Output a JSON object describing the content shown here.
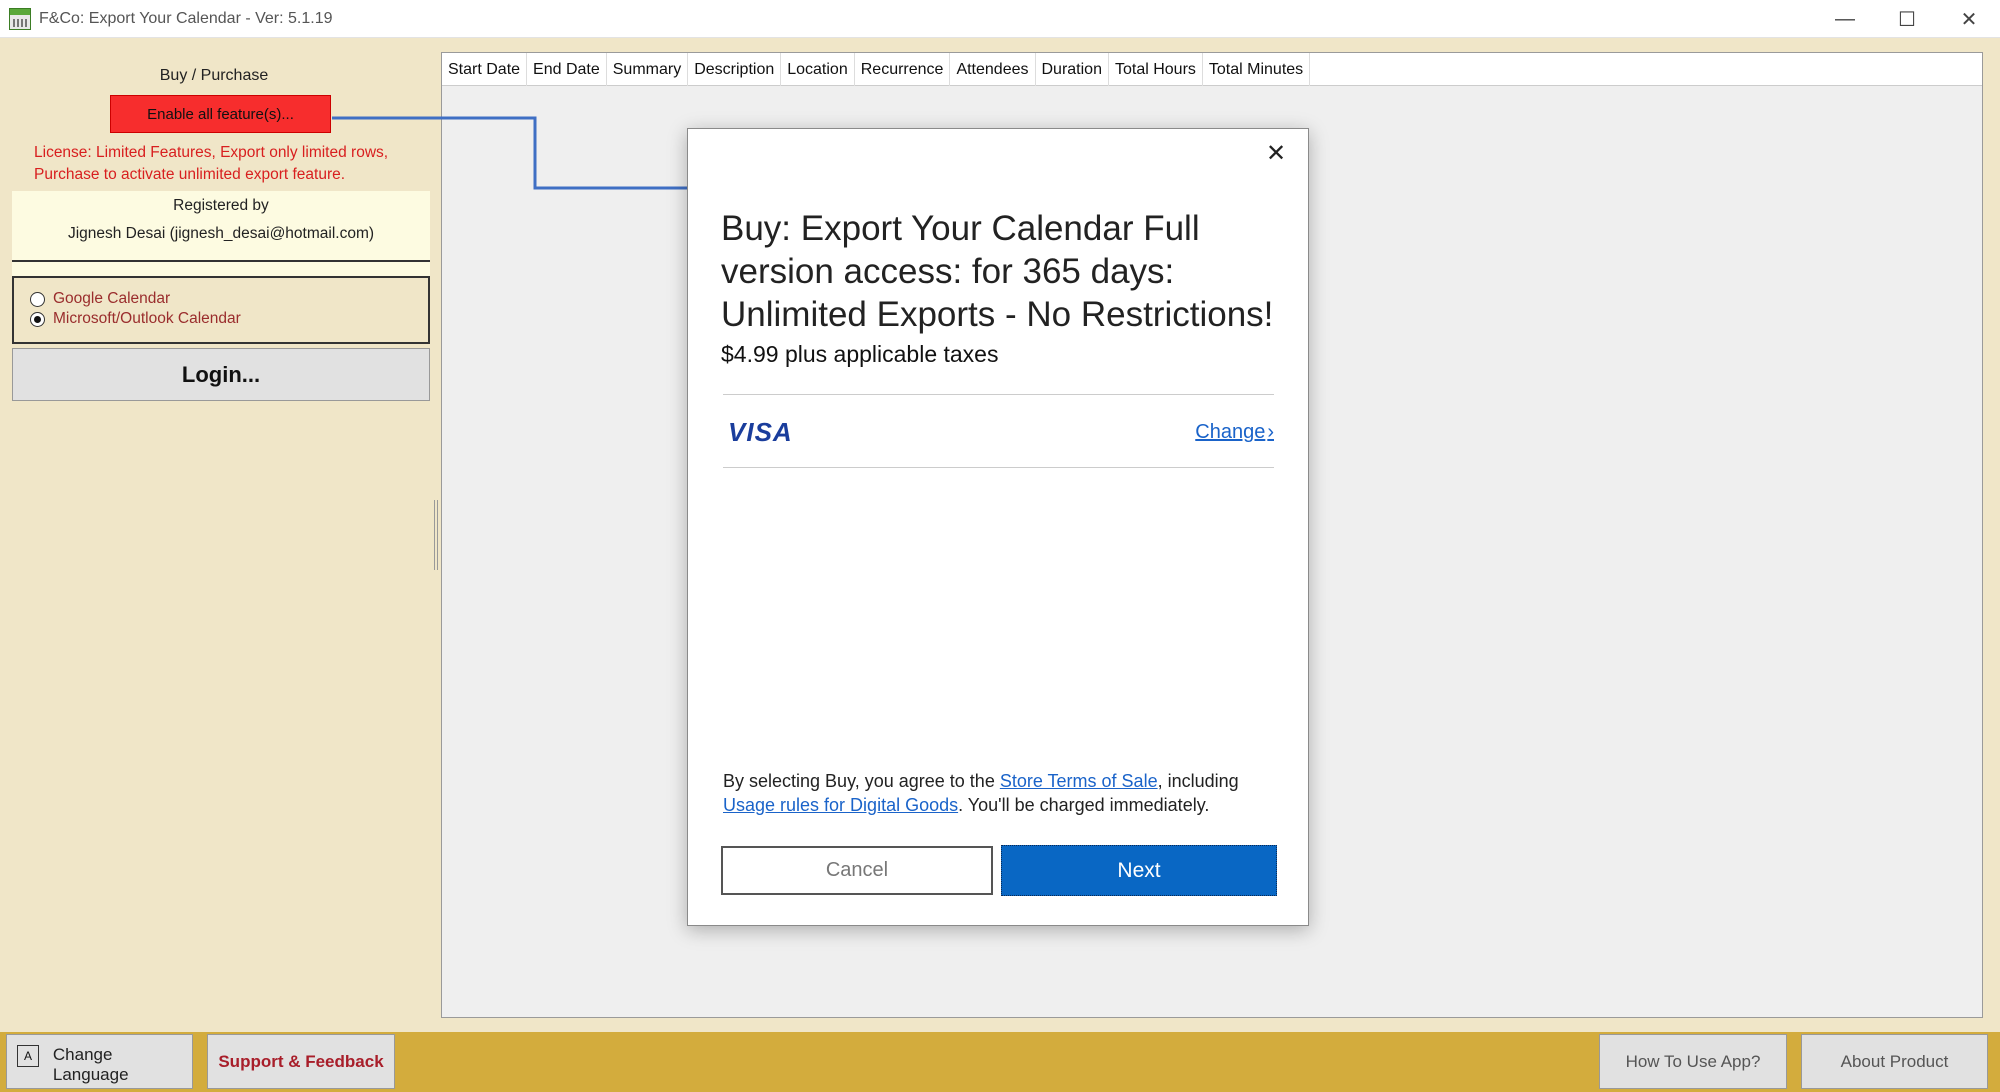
{
  "window": {
    "title": "F&Co: Export Your Calendar - Ver: 5.1.19",
    "controls": {
      "minimize": "—",
      "maximize": "☐",
      "close": "✕"
    }
  },
  "left": {
    "buy_label": "Buy / Purchase",
    "enable_button": "Enable all feature(s)...",
    "license_line1": "License: Limited Features, Export only limited rows,",
    "license_line2": "Purchase to activate unlimited export feature.",
    "registered_by": "Registered by",
    "registered_user": "Jignesh Desai (jignesh_desai@hotmail.com)",
    "calendar_options": [
      {
        "label": "Google Calendar",
        "checked": false
      },
      {
        "label": "Microsoft/Outlook Calendar",
        "checked": true
      }
    ],
    "login_button": "Login..."
  },
  "grid": {
    "columns": [
      "Start Date",
      "End Date",
      "Summary",
      "Description",
      "Location",
      "Recurrence",
      "Attendees",
      "Duration",
      "Total Hours",
      "Total Minutes"
    ]
  },
  "dialog": {
    "close_label": "✕",
    "title": "Buy: Export Your Calendar Full version access: for 365 days: Unlimited Exports - No Restrictions!",
    "price": "$4.99 plus applicable taxes",
    "payment_method": "VISA",
    "change_link": "Change",
    "terms_prefix": "By selecting Buy, you agree to the ",
    "terms_link1": "Store Terms of Sale",
    "terms_mid": ", including ",
    "terms_link2": "Usage rules for Digital Goods",
    "terms_suffix": ". You'll be charged immediately.",
    "cancel_button": "Cancel",
    "next_button": "Next"
  },
  "bottom": {
    "change_language": "Change Language",
    "support": "Support & Feedback",
    "how_to": "How To Use App?",
    "about": "About Product"
  },
  "colors": {
    "panel_bg": "#f0e6c8",
    "enable_btn": "#f72d2d",
    "license_text": "#d81f1f",
    "arrow": "#3f6fc4",
    "next_btn": "#0967c4",
    "bottom_bar": "#d3ac3d"
  }
}
